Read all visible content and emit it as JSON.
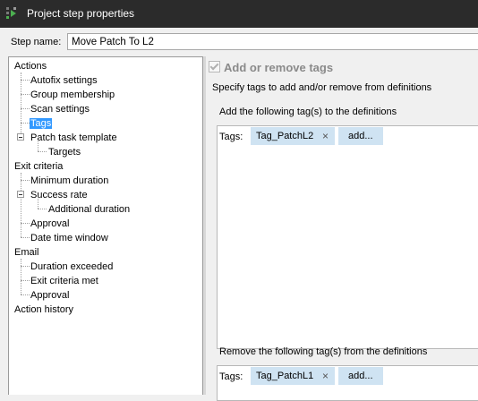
{
  "window": {
    "title": "Project step properties",
    "app_icon": "project-step-icon"
  },
  "step_name": {
    "label": "Step name:",
    "value": "Move Patch To L2"
  },
  "tree": {
    "items": [
      "Actions",
      "Autofix settings",
      "Group membership",
      "Scan settings",
      "Tags",
      "Patch task template",
      "Targets",
      "Exit criteria",
      "Minimum duration",
      "Success rate",
      "Additional duration",
      "Approval",
      "Date time window",
      "Email",
      "Duration exceeded",
      "Exit criteria met",
      "Approval",
      "Action history"
    ],
    "selected": "Tags"
  },
  "panel": {
    "heading": "Add or remove tags",
    "description": "Specify tags to add and/or remove from definitions",
    "add_section": {
      "label": "Add the following tag(s) to the definitions",
      "tags_label": "Tags:",
      "tags": [
        "Tag_PatchL2"
      ],
      "add_button": "add..."
    },
    "remove_section": {
      "label": "Remove the following tag(s) from the definitions",
      "tags_label": "Tags:",
      "tags": [
        "Tag_PatchL1"
      ],
      "add_button": "add..."
    },
    "chip_close_glyph": "×"
  }
}
